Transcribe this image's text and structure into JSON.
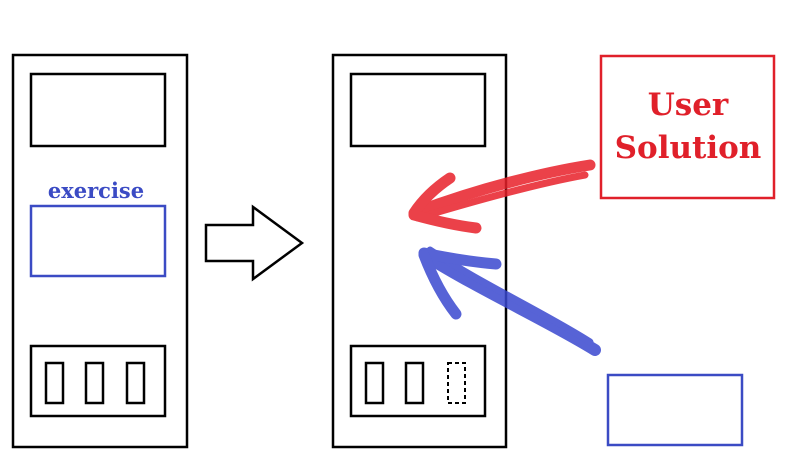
{
  "left_panel": {
    "exercise_label": "exercise",
    "slot_count": 3
  },
  "right_panel": {
    "solid_slots": 2,
    "dashed_slots": 1
  },
  "user_solution_box": {
    "line1": "User",
    "line2": "Solution"
  },
  "colors": {
    "outline": "#000000",
    "exercise": "#3b4bc4",
    "user_solution": "#e0202a",
    "red_arrow": "#e8202a",
    "blue_arrow": "#3a48d0"
  }
}
